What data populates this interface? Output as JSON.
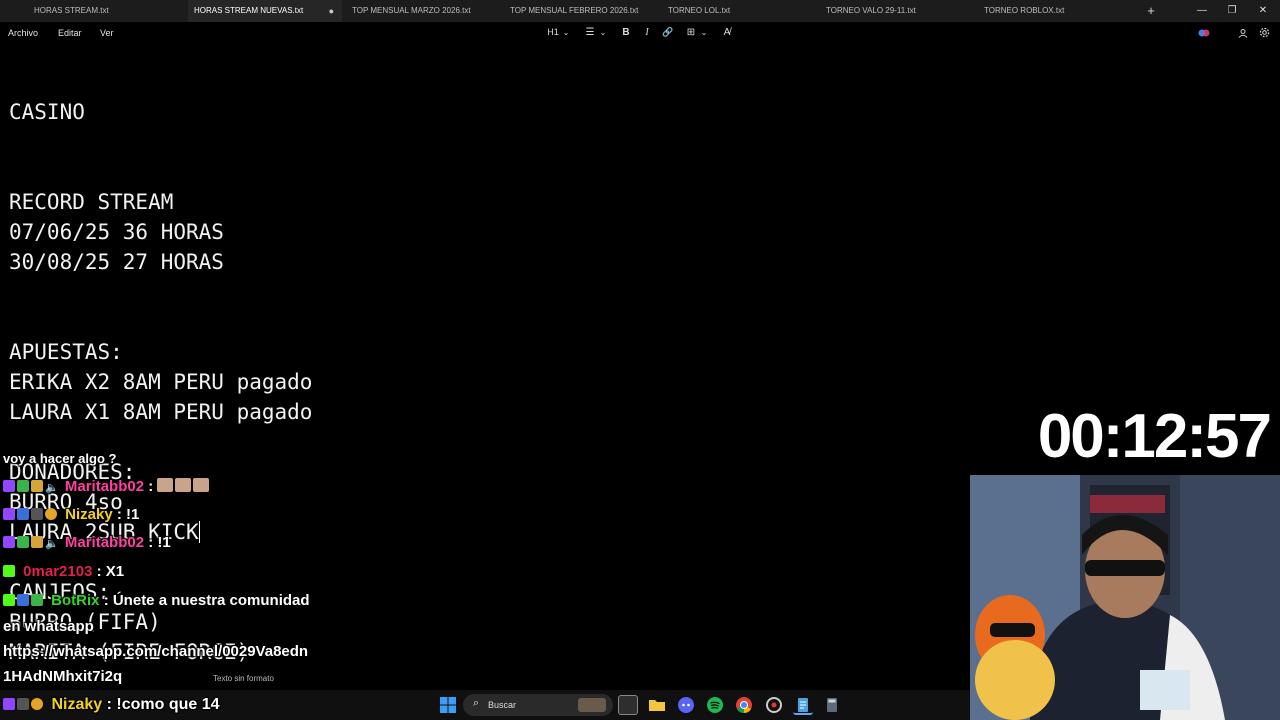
{
  "tabs": [
    {
      "label": "HORAS STREAM.txt",
      "active": false
    },
    {
      "label": "HORAS STREAM NUEVAS.txt",
      "active": true,
      "modified_marker": "●"
    },
    {
      "label": "TOP MENSUAL MARZO 2026.txt",
      "active": false
    },
    {
      "label": "TOP MENSUAL FEBRERO 2026.txt",
      "active": false
    },
    {
      "label": "TORNEO LOL.txt",
      "active": false
    },
    {
      "label": "TORNEO VALO 29-11.txt",
      "active": false
    },
    {
      "label": "TORNEO ROBLOX.txt",
      "active": false
    }
  ],
  "tab_add_label": "+",
  "window_controls": {
    "minimize": "—",
    "maximize": "❐",
    "close": "✕"
  },
  "menu": {
    "file": "Archivo",
    "edit": "Editar",
    "view": "Ver"
  },
  "toolbar": {
    "heading": "H1",
    "heading_caret": "⌄",
    "list": "☰",
    "list_caret": "⌄",
    "bold": "B",
    "italic": "I",
    "link": "🔗",
    "table": "⊞",
    "table_caret": "⌄",
    "clear_format": "A̸"
  },
  "editor_lines": [
    "CASINO",
    "RECORD STREAM",
    "07/06/25 36 HORAS",
    "30/08/25 27 HORAS",
    "APUESTAS:",
    "ERIKA X2 8AM PERU pagado",
    "LAURA X1 8AM PERU pagado",
    "DONADORES:",
    "BURRO 4so",
    "LAURA 2SUB KICK",
    "CANJEOS:",
    "BURRO (FIFA)",
    "MARITA (FIRE FORCE)"
  ],
  "status_bar": {
    "format": "Texto sin formato"
  },
  "taskbar": {
    "search_placeholder": "Buscar",
    "search_icon": "search-icon"
  },
  "timer": "00:12:57",
  "chat": {
    "messages": [
      {
        "user": "",
        "text": "voy a hacer algo ?",
        "user_color": "#ffffff"
      },
      {
        "user": "Maritabb02",
        "text": ":",
        "user_color": "#ff3fa4"
      },
      {
        "user": "Nizaky",
        "text": ": !1",
        "user_color": "#f3d21f"
      },
      {
        "user": "Maritabb02",
        "text": ": !1",
        "user_color": "#ff3fa4"
      },
      {
        "user": "0mar2103",
        "text": ": X1",
        "user_color": "#e0224a"
      },
      {
        "user": "BotRix",
        "text": ": Únete a nuestra comunidad",
        "user_color": "#35d62b"
      },
      {
        "user": "",
        "text": "en whatsapp",
        "user_color": "#ffffff"
      },
      {
        "user": "",
        "text": "https://whatsapp.com/channel/0029Va8edn",
        "user_color": "#ffffff"
      },
      {
        "user": "",
        "text": "1HAdNMhxit7i2q",
        "user_color": "#ffffff"
      },
      {
        "user": "Nizaky",
        "text": ": !como que 14",
        "user_color": "#f3d21f"
      }
    ]
  },
  "colors": {
    "editor_bg": "#000000",
    "tabbar_bg": "#1c1c1c",
    "active_tab_bg": "#262626",
    "taskbar_bg": "#101010"
  }
}
